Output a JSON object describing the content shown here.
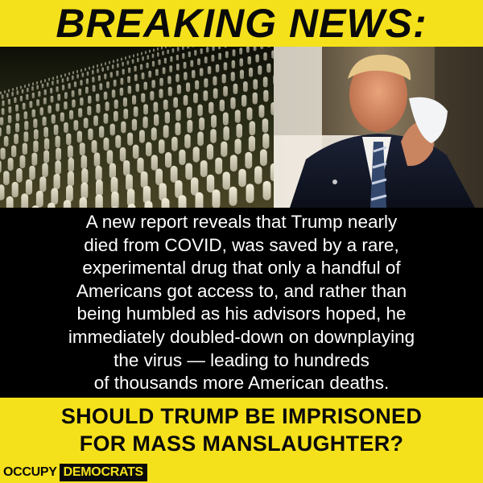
{
  "headline": "BREAKING NEWS:",
  "body_text": "A new report reveals that Trump nearly died from COVID, was saved by a rare, experimental drug that only a handful of Americans got access to, and rather than being humbled as his advisors hoped, he immediately doubled-down on downplaying the virus — leading to hundreds of thousands more American deaths.",
  "body_lines": [
    "A new report reveals that Trump nearly",
    "died from COVID, was saved by a rare,",
    "experimental drug that only a handful of",
    "Americans got access to, and rather than",
    "being humbled as his advisors hoped, he",
    "immediately doubled-down on downplaying",
    "the virus — leading to hundreds",
    "of thousands more American deaths."
  ],
  "question_lines": [
    "SHOULD TRUMP BE IMPRISONED",
    "FOR MASS MANSLAUGHTER?"
  ],
  "logo": {
    "word1": "OCCUPY",
    "word2": "DEMOCRATS"
  },
  "colors": {
    "accent_yellow": "#f5e11b",
    "background": "#000000",
    "text_dark": "#0a0a0a",
    "text_light": "#ffffff"
  },
  "images": {
    "left": "cemetery-gravestones-photo",
    "right": "man-removing-face-mask-photo"
  }
}
